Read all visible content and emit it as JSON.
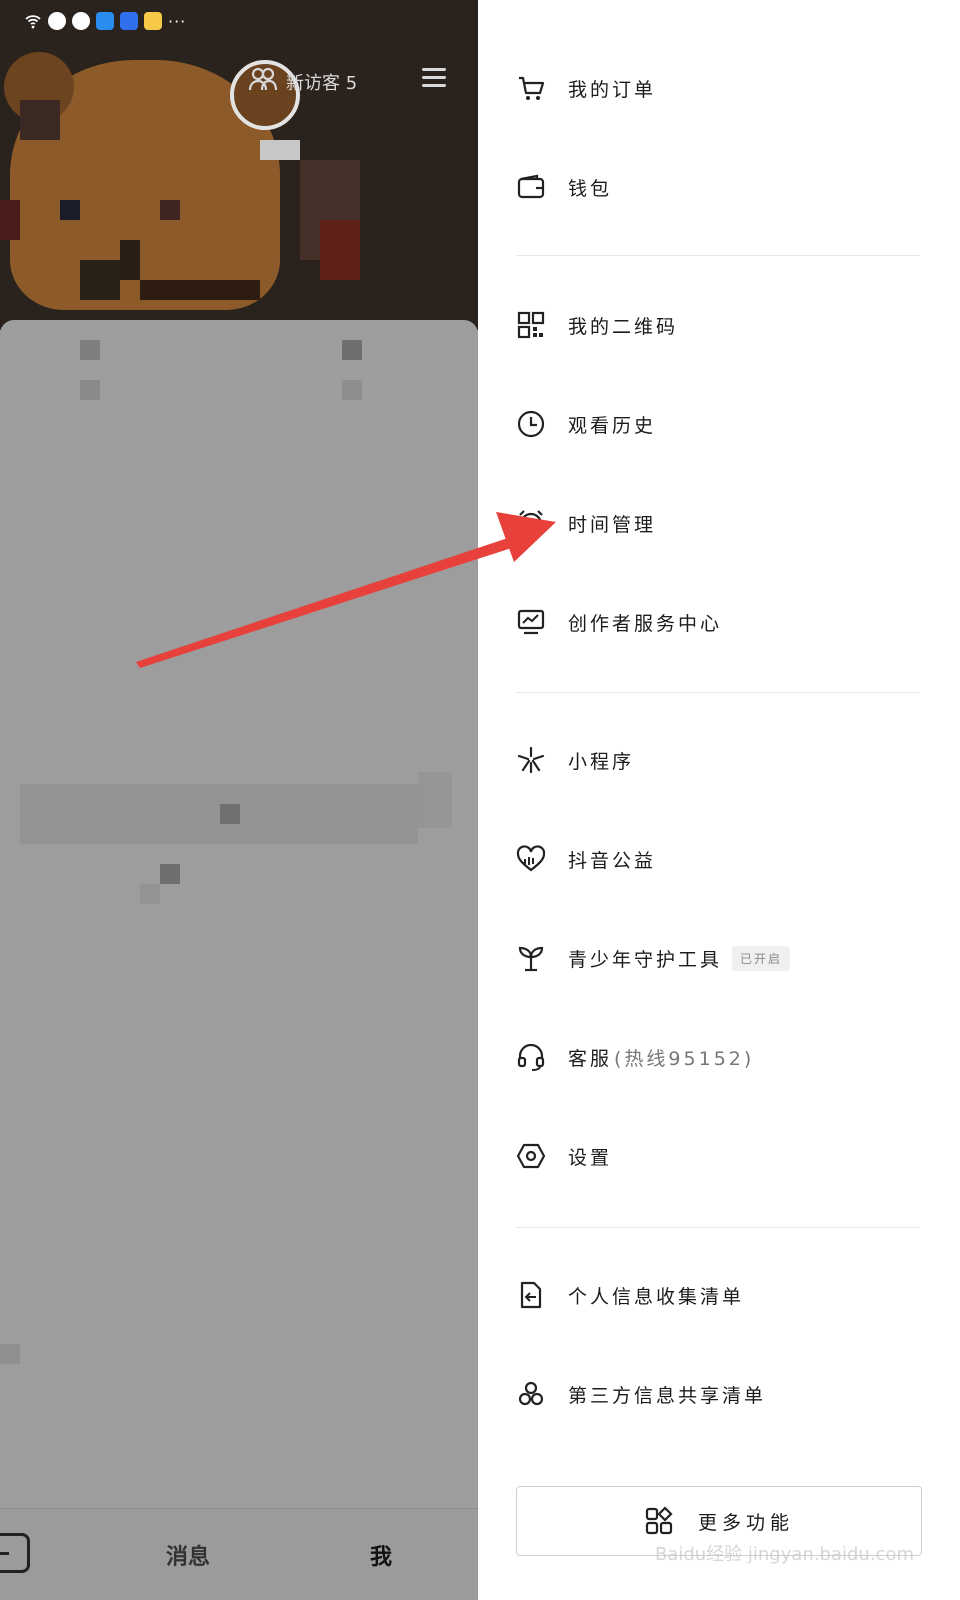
{
  "status_bar": {
    "more": "···"
  },
  "header": {
    "visitors_label": "新访客 5"
  },
  "bottom_nav": {
    "messages": "消息",
    "me": "我"
  },
  "drawer": {
    "items": [
      {
        "label": "我的订单",
        "icon": "cart-icon"
      },
      {
        "label": "钱包",
        "icon": "wallet-icon"
      },
      {
        "label": "我的二维码",
        "icon": "qr-code-icon"
      },
      {
        "label": "观看历史",
        "icon": "clock-icon"
      },
      {
        "label": "时间管理",
        "icon": "alarm-clock-icon"
      },
      {
        "label": "创作者服务中心",
        "icon": "monitor-chart-icon"
      },
      {
        "label": "小程序",
        "icon": "mini-program-icon"
      },
      {
        "label": "抖音公益",
        "icon": "charity-heart-icon"
      },
      {
        "label": "青少年守护工具",
        "badge": "已开启",
        "icon": "sprout-icon"
      },
      {
        "label": "客服",
        "sub": "(热线95152)",
        "icon": "headset-icon"
      },
      {
        "label": "设置",
        "icon": "settings-hexagon-icon"
      },
      {
        "label": "个人信息收集清单",
        "icon": "document-arrow-icon"
      },
      {
        "label": "第三方信息共享清单",
        "icon": "share-circles-icon"
      }
    ],
    "more_button": {
      "label": "更多功能",
      "icon": "apps-grid-icon"
    }
  },
  "watermark": "Baidu经验 jingyan.baidu.com",
  "colors": {
    "arrow": "#e8413c",
    "drawer_bg": "#ffffff",
    "dim_bg": "#9c9c9c"
  }
}
